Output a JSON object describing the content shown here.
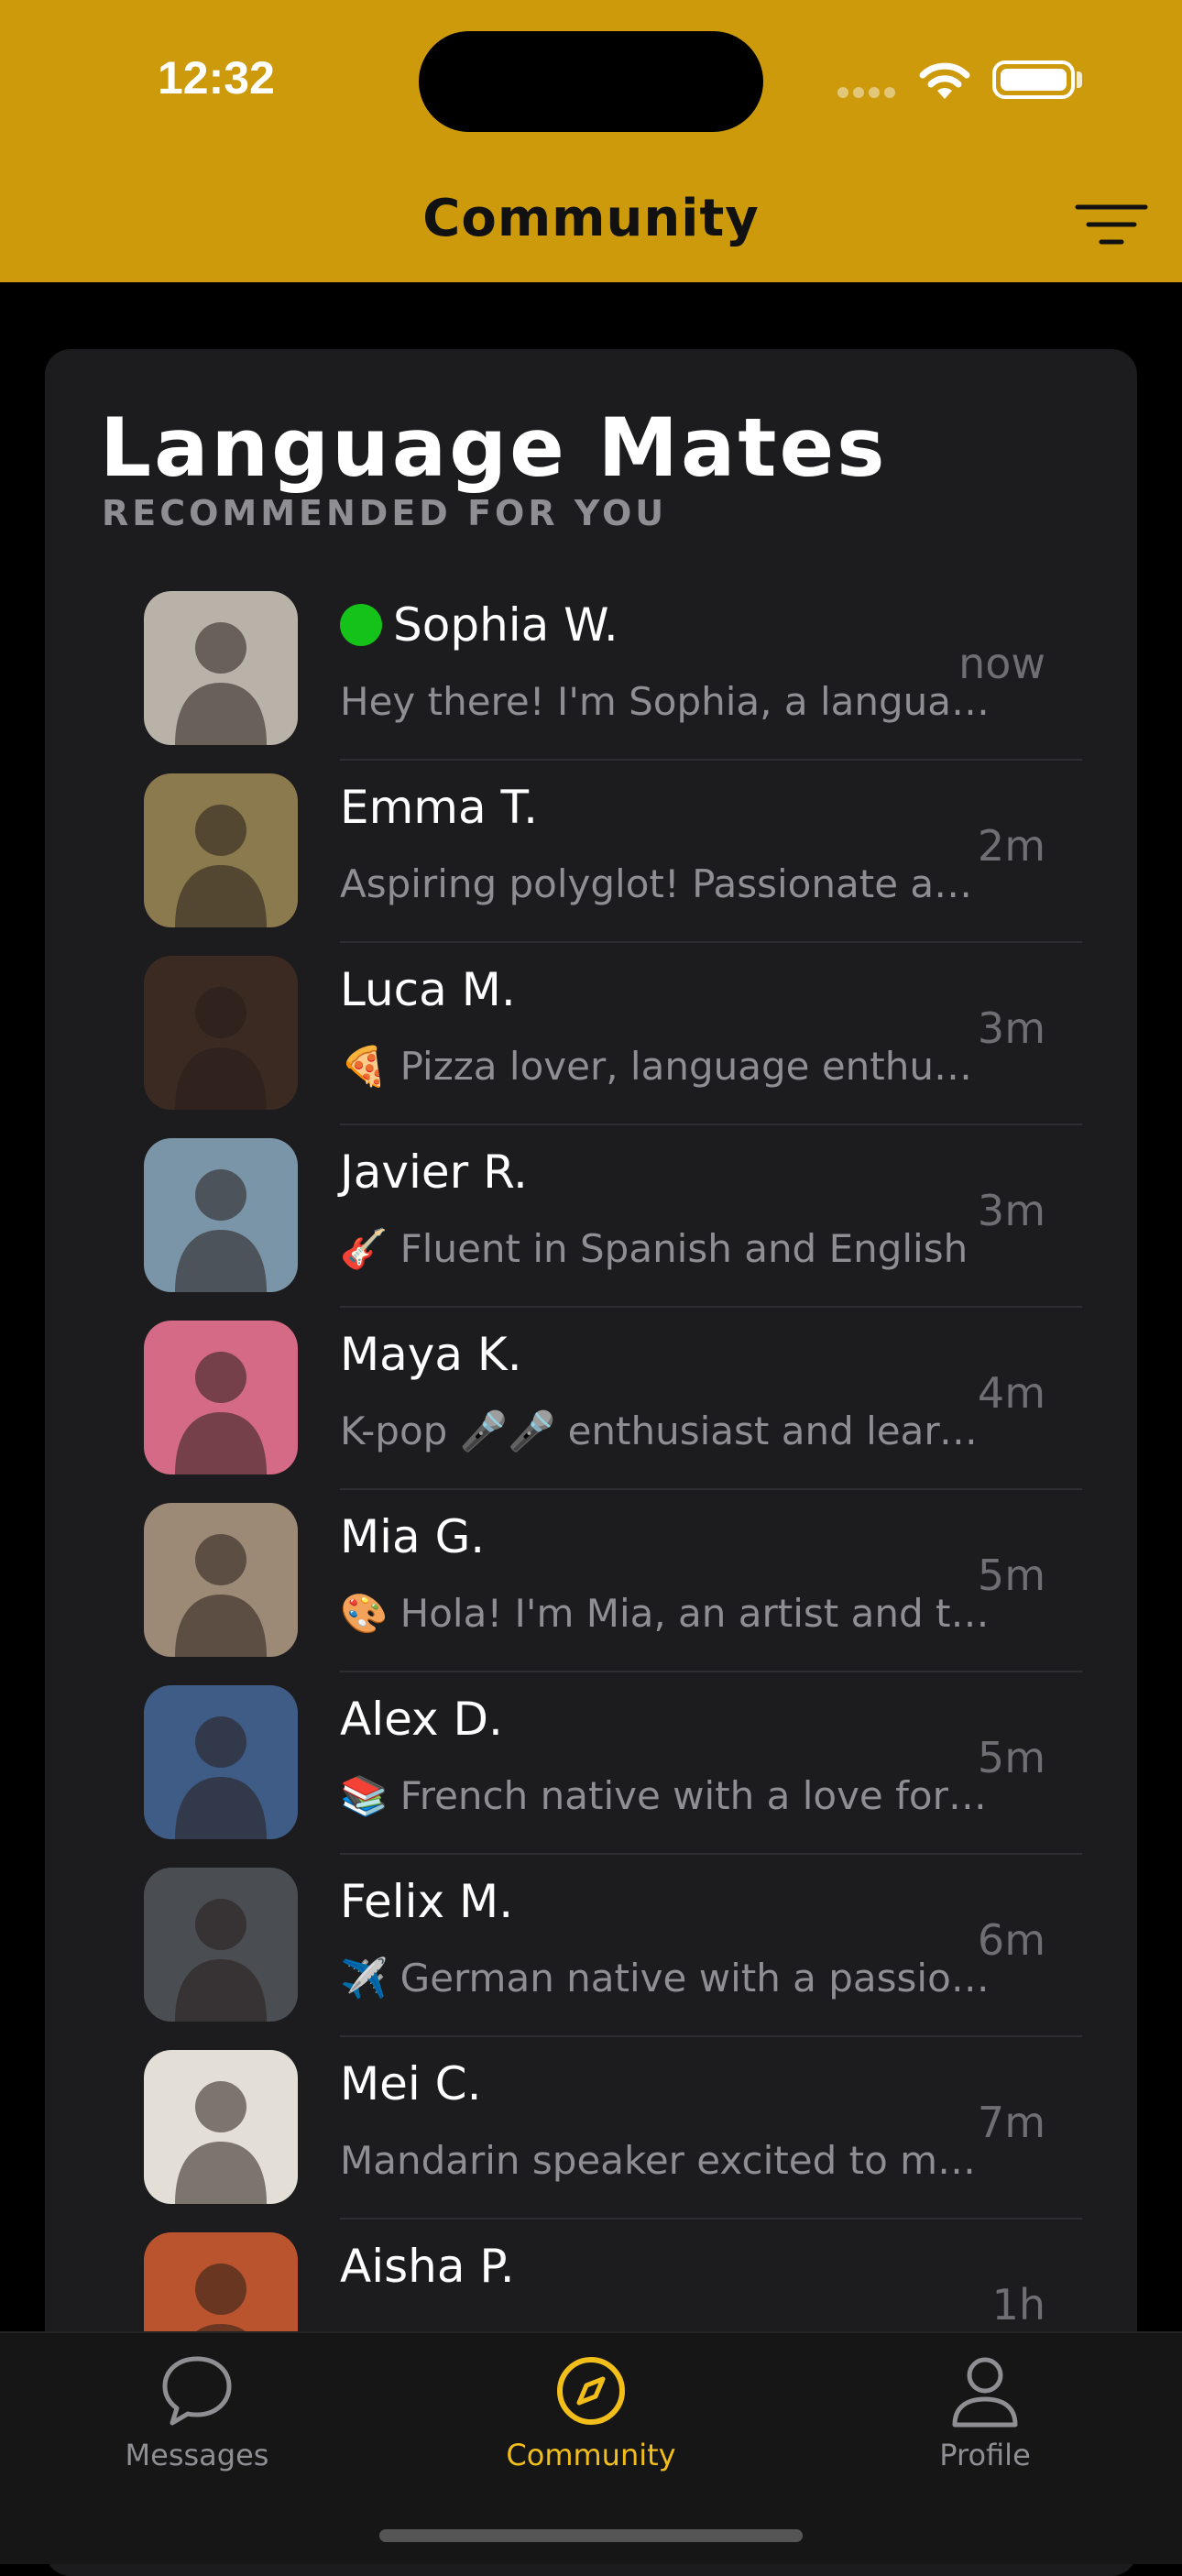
{
  "status": {
    "time": "12:32"
  },
  "header": {
    "title": "Community",
    "filter_icon": "filter-lines-icon"
  },
  "section": {
    "title": "Language Mates",
    "subtitle": "RECOMMENDED FOR YOU"
  },
  "contacts": [
    {
      "name": "Sophia W.",
      "online": true,
      "snippet": "Hey there! I'm Sophia, a language lover",
      "time": "now",
      "avatar_color": "#B9B2A8"
    },
    {
      "name": "Emma T.",
      "online": false,
      "snippet": "Aspiring polyglot! Passionate about languages",
      "time": "2m",
      "avatar_color": "#8A7A4E"
    },
    {
      "name": "Luca M.",
      "online": false,
      "snippet": "🍕 Pizza lover, language enthusiast",
      "time": "3m",
      "avatar_color": "#3B2A22"
    },
    {
      "name": "Javier R.",
      "online": false,
      "snippet": "🎸 Fluent in Spanish and English",
      "time": "3m",
      "avatar_color": "#7A95A8"
    },
    {
      "name": "Maya K.",
      "online": false,
      "snippet": "K-pop 🎤🎤 enthusiast and learner",
      "time": "4m",
      "avatar_color": "#D46A86"
    },
    {
      "name": "Mia G.",
      "online": false,
      "snippet": "🎨 Hola! I'm Mia, an artist and traveler",
      "time": "5m",
      "avatar_color": "#9C8A76"
    },
    {
      "name": "Alex D.",
      "online": false,
      "snippet": "📚 French native with a love for books",
      "time": "5m",
      "avatar_color": "#3E5C86"
    },
    {
      "name": "Felix M.",
      "online": false,
      "snippet": "✈️ German native with a passion for flying",
      "time": "6m",
      "avatar_color": "#4A4D52"
    },
    {
      "name": "Mei C.",
      "online": false,
      "snippet": "Mandarin speaker excited to meet you",
      "time": "7m",
      "avatar_color": "#E3DFD6"
    },
    {
      "name": "Aisha P.",
      "online": false,
      "snippet": "",
      "time": "1h",
      "avatar_color": "#B9542E"
    }
  ],
  "tabs": [
    {
      "label": "Messages",
      "icon": "chat-bubble-icon",
      "active": false
    },
    {
      "label": "Community",
      "icon": "compass-icon",
      "active": true
    },
    {
      "label": "Profile",
      "icon": "person-icon",
      "active": false
    }
  ],
  "colors": {
    "accent": "#CC9A0A",
    "online": "#14C21A",
    "tab_active": "#F2BE1A"
  }
}
